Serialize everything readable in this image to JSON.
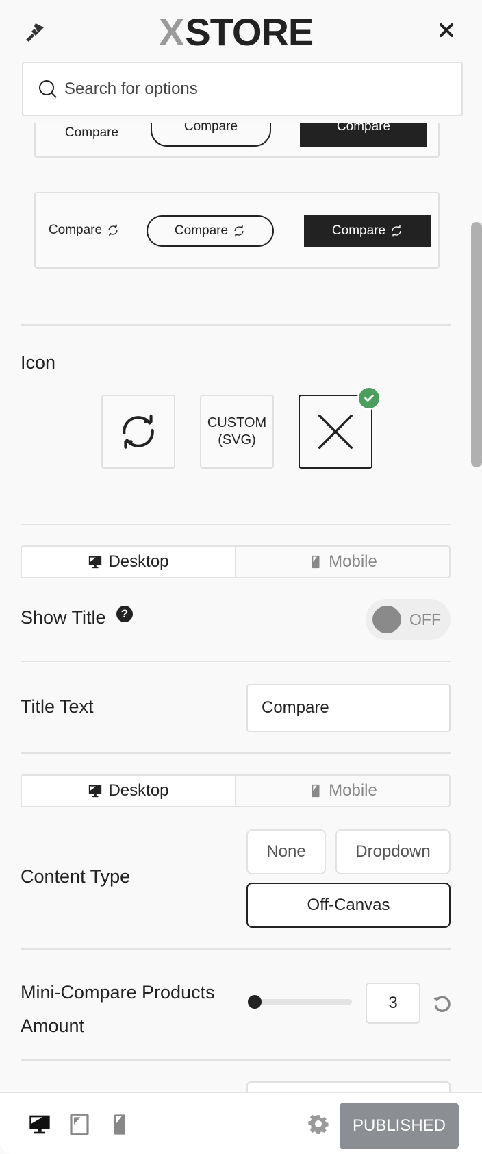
{
  "header": {
    "logo_mark": "X",
    "logo_text": "STORE",
    "search_placeholder": "Search for options"
  },
  "previews": {
    "style_row_a": [
      "Compare",
      "Compare",
      "Compare"
    ],
    "style_row_b": [
      "Compare",
      "Compare",
      "Compare"
    ]
  },
  "icon_section": {
    "label": "Icon",
    "options": [
      {
        "name": "sync-arrows-icon",
        "label": ""
      },
      {
        "name": "custom-svg",
        "label_line1": "CUSTOM",
        "label_line2": "(SVG)"
      },
      {
        "name": "close-x-icon",
        "label": "",
        "selected": true
      }
    ]
  },
  "device_tabs_1": {
    "desktop": "Desktop",
    "mobile": "Mobile",
    "active": "desktop"
  },
  "show_title": {
    "label": "Show Title",
    "help": "?",
    "state": "OFF"
  },
  "title_text": {
    "label": "Title Text",
    "value": "Compare"
  },
  "device_tabs_2": {
    "desktop": "Desktop",
    "mobile": "Mobile",
    "active": "desktop"
  },
  "content_type": {
    "label": "Content Type",
    "options": [
      "None",
      "Dropdown",
      "Off-Canvas"
    ],
    "selected": "Off-Canvas"
  },
  "mini_compare": {
    "label_line1": "Mini-Compare Products",
    "label_line2": "Amount",
    "value": "3",
    "slider_fraction": 0.0
  },
  "footer": {
    "publish_label": "PUBLISHED",
    "active_device": "desktop"
  },
  "colors": {
    "accent_dark": "#222222",
    "check_green": "#4b9e5e",
    "publish_gray": "#8b8e93"
  }
}
